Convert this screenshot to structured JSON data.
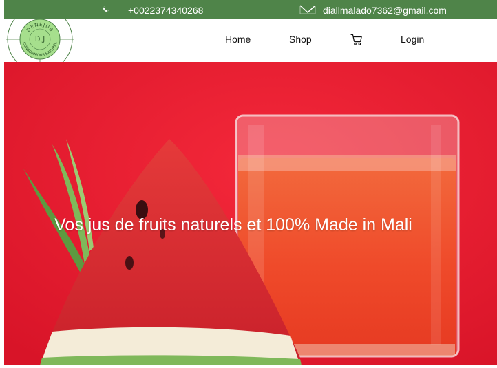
{
  "topbar": {
    "phone": "+0022374340268",
    "email": "diallmalado7362@gmail.com",
    "background_color": "#4f8449",
    "phone_icon": "phone-icon",
    "email_icon": "envelope-icon"
  },
  "logo": {
    "name": "DENEJUS",
    "tagline": "CONSOMMONS NATUREL",
    "monogram": "D J"
  },
  "nav": {
    "home": "Home",
    "shop": "Shop",
    "cart_icon": "cart-icon",
    "login": "Login"
  },
  "hero": {
    "headline": "Vos jus de fruits naturels et 100% Made in Mali",
    "background_color": "#ee1d32"
  }
}
